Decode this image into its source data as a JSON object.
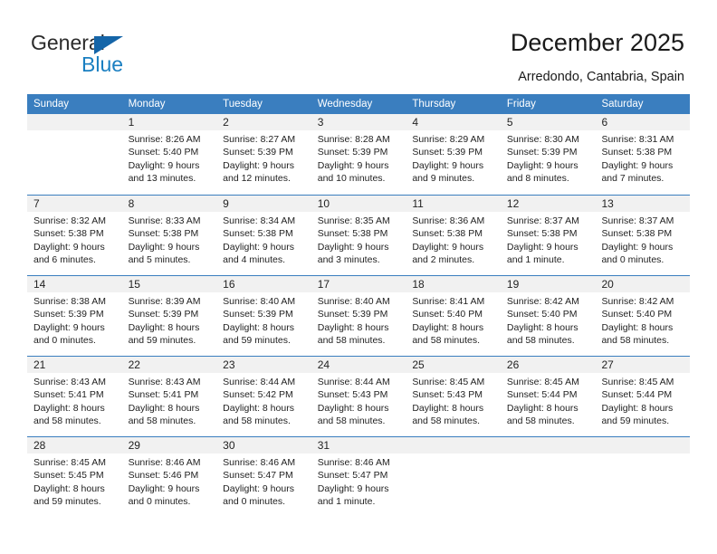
{
  "brand": {
    "name_part1": "General",
    "name_part2": "Blue",
    "accent_color": "#1a7fc1",
    "triangle_color": "#1565a8"
  },
  "header": {
    "title": "December 2025",
    "subtitle": "Arredondo, Cantabria, Spain"
  },
  "calendar": {
    "header_bg": "#3a7ebf",
    "day_band_bg": "#f1f1f1",
    "weekdays": [
      "Sunday",
      "Monday",
      "Tuesday",
      "Wednesday",
      "Thursday",
      "Friday",
      "Saturday"
    ],
    "weeks": [
      [
        {
          "day": "",
          "lines": []
        },
        {
          "day": "1",
          "lines": [
            "Sunrise: 8:26 AM",
            "Sunset: 5:40 PM",
            "Daylight: 9 hours",
            "and 13 minutes."
          ]
        },
        {
          "day": "2",
          "lines": [
            "Sunrise: 8:27 AM",
            "Sunset: 5:39 PM",
            "Daylight: 9 hours",
            "and 12 minutes."
          ]
        },
        {
          "day": "3",
          "lines": [
            "Sunrise: 8:28 AM",
            "Sunset: 5:39 PM",
            "Daylight: 9 hours",
            "and 10 minutes."
          ]
        },
        {
          "day": "4",
          "lines": [
            "Sunrise: 8:29 AM",
            "Sunset: 5:39 PM",
            "Daylight: 9 hours",
            "and 9 minutes."
          ]
        },
        {
          "day": "5",
          "lines": [
            "Sunrise: 8:30 AM",
            "Sunset: 5:39 PM",
            "Daylight: 9 hours",
            "and 8 minutes."
          ]
        },
        {
          "day": "6",
          "lines": [
            "Sunrise: 8:31 AM",
            "Sunset: 5:38 PM",
            "Daylight: 9 hours",
            "and 7 minutes."
          ]
        }
      ],
      [
        {
          "day": "7",
          "lines": [
            "Sunrise: 8:32 AM",
            "Sunset: 5:38 PM",
            "Daylight: 9 hours",
            "and 6 minutes."
          ]
        },
        {
          "day": "8",
          "lines": [
            "Sunrise: 8:33 AM",
            "Sunset: 5:38 PM",
            "Daylight: 9 hours",
            "and 5 minutes."
          ]
        },
        {
          "day": "9",
          "lines": [
            "Sunrise: 8:34 AM",
            "Sunset: 5:38 PM",
            "Daylight: 9 hours",
            "and 4 minutes."
          ]
        },
        {
          "day": "10",
          "lines": [
            "Sunrise: 8:35 AM",
            "Sunset: 5:38 PM",
            "Daylight: 9 hours",
            "and 3 minutes."
          ]
        },
        {
          "day": "11",
          "lines": [
            "Sunrise: 8:36 AM",
            "Sunset: 5:38 PM",
            "Daylight: 9 hours",
            "and 2 minutes."
          ]
        },
        {
          "day": "12",
          "lines": [
            "Sunrise: 8:37 AM",
            "Sunset: 5:38 PM",
            "Daylight: 9 hours",
            "and 1 minute."
          ]
        },
        {
          "day": "13",
          "lines": [
            "Sunrise: 8:37 AM",
            "Sunset: 5:38 PM",
            "Daylight: 9 hours",
            "and 0 minutes."
          ]
        }
      ],
      [
        {
          "day": "14",
          "lines": [
            "Sunrise: 8:38 AM",
            "Sunset: 5:39 PM",
            "Daylight: 9 hours",
            "and 0 minutes."
          ]
        },
        {
          "day": "15",
          "lines": [
            "Sunrise: 8:39 AM",
            "Sunset: 5:39 PM",
            "Daylight: 8 hours",
            "and 59 minutes."
          ]
        },
        {
          "day": "16",
          "lines": [
            "Sunrise: 8:40 AM",
            "Sunset: 5:39 PM",
            "Daylight: 8 hours",
            "and 59 minutes."
          ]
        },
        {
          "day": "17",
          "lines": [
            "Sunrise: 8:40 AM",
            "Sunset: 5:39 PM",
            "Daylight: 8 hours",
            "and 58 minutes."
          ]
        },
        {
          "day": "18",
          "lines": [
            "Sunrise: 8:41 AM",
            "Sunset: 5:40 PM",
            "Daylight: 8 hours",
            "and 58 minutes."
          ]
        },
        {
          "day": "19",
          "lines": [
            "Sunrise: 8:42 AM",
            "Sunset: 5:40 PM",
            "Daylight: 8 hours",
            "and 58 minutes."
          ]
        },
        {
          "day": "20",
          "lines": [
            "Sunrise: 8:42 AM",
            "Sunset: 5:40 PM",
            "Daylight: 8 hours",
            "and 58 minutes."
          ]
        }
      ],
      [
        {
          "day": "21",
          "lines": [
            "Sunrise: 8:43 AM",
            "Sunset: 5:41 PM",
            "Daylight: 8 hours",
            "and 58 minutes."
          ]
        },
        {
          "day": "22",
          "lines": [
            "Sunrise: 8:43 AM",
            "Sunset: 5:41 PM",
            "Daylight: 8 hours",
            "and 58 minutes."
          ]
        },
        {
          "day": "23",
          "lines": [
            "Sunrise: 8:44 AM",
            "Sunset: 5:42 PM",
            "Daylight: 8 hours",
            "and 58 minutes."
          ]
        },
        {
          "day": "24",
          "lines": [
            "Sunrise: 8:44 AM",
            "Sunset: 5:43 PM",
            "Daylight: 8 hours",
            "and 58 minutes."
          ]
        },
        {
          "day": "25",
          "lines": [
            "Sunrise: 8:45 AM",
            "Sunset: 5:43 PM",
            "Daylight: 8 hours",
            "and 58 minutes."
          ]
        },
        {
          "day": "26",
          "lines": [
            "Sunrise: 8:45 AM",
            "Sunset: 5:44 PM",
            "Daylight: 8 hours",
            "and 58 minutes."
          ]
        },
        {
          "day": "27",
          "lines": [
            "Sunrise: 8:45 AM",
            "Sunset: 5:44 PM",
            "Daylight: 8 hours",
            "and 59 minutes."
          ]
        }
      ],
      [
        {
          "day": "28",
          "lines": [
            "Sunrise: 8:45 AM",
            "Sunset: 5:45 PM",
            "Daylight: 8 hours",
            "and 59 minutes."
          ]
        },
        {
          "day": "29",
          "lines": [
            "Sunrise: 8:46 AM",
            "Sunset: 5:46 PM",
            "Daylight: 9 hours",
            "and 0 minutes."
          ]
        },
        {
          "day": "30",
          "lines": [
            "Sunrise: 8:46 AM",
            "Sunset: 5:47 PM",
            "Daylight: 9 hours",
            "and 0 minutes."
          ]
        },
        {
          "day": "31",
          "lines": [
            "Sunrise: 8:46 AM",
            "Sunset: 5:47 PM",
            "Daylight: 9 hours",
            "and 1 minute."
          ]
        },
        {
          "day": "",
          "lines": []
        },
        {
          "day": "",
          "lines": []
        },
        {
          "day": "",
          "lines": []
        }
      ]
    ]
  }
}
